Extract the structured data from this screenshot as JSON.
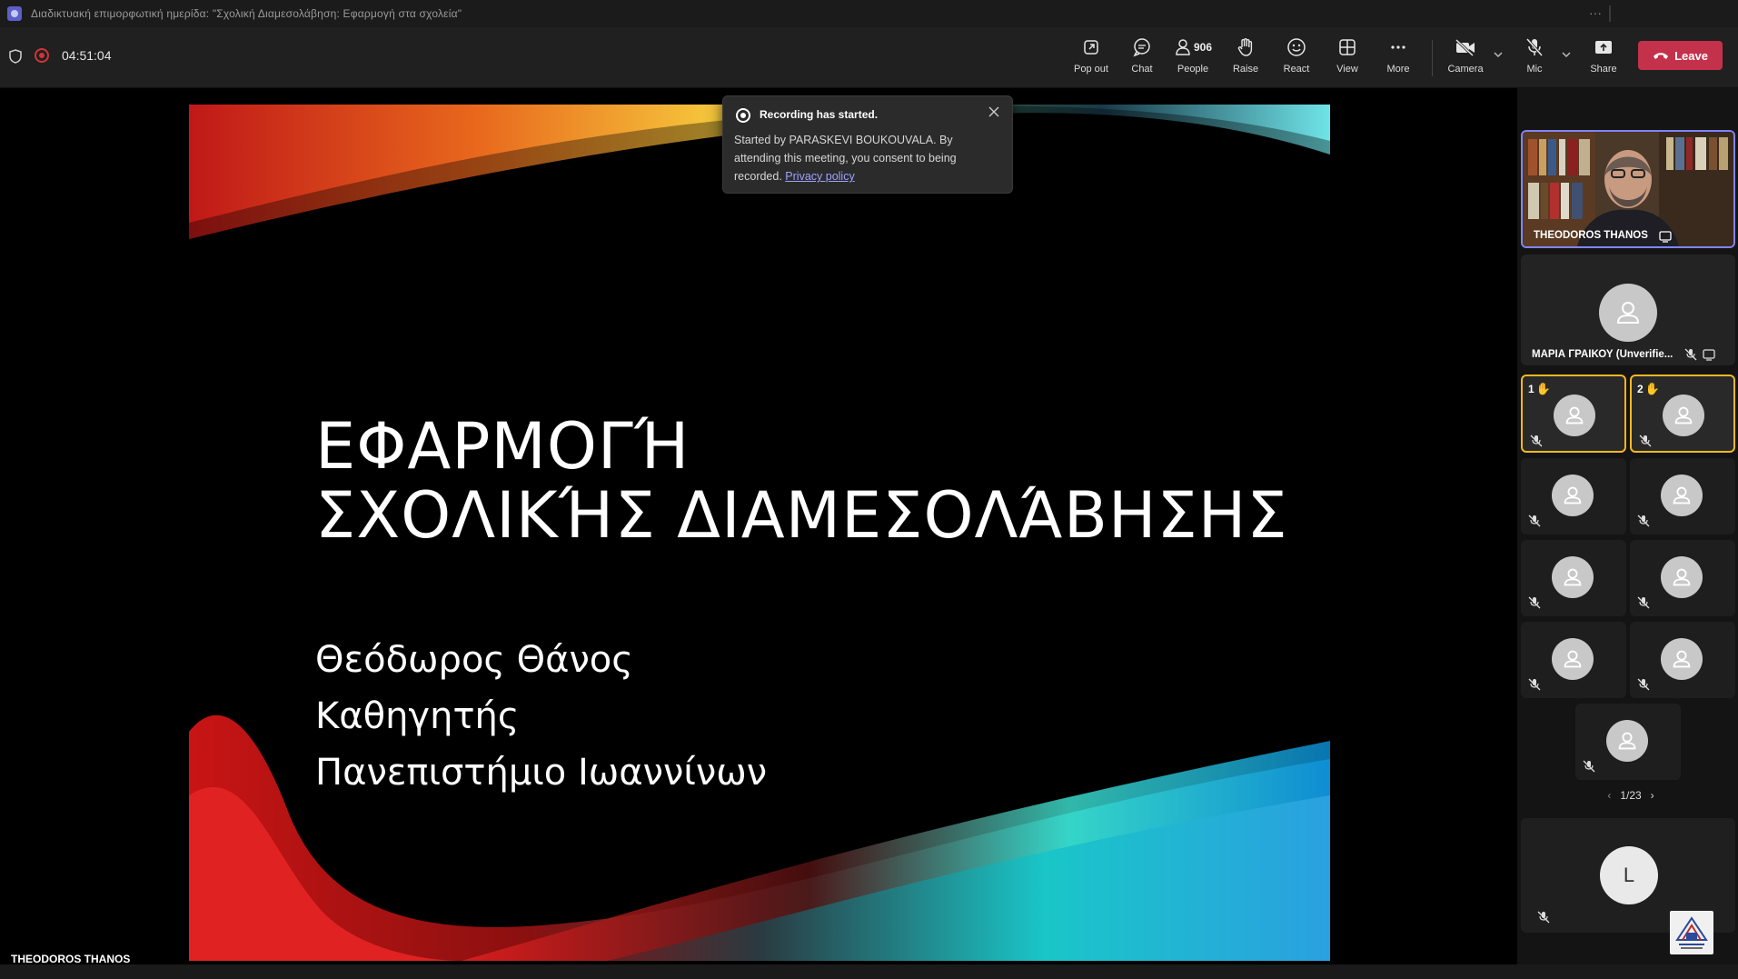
{
  "window": {
    "title": "Διαδικτυακή επιμορφωτική ημερίδα: \"Σχολική Διαμεσολάβηση: Εφαρμογή στα σχολεία\"",
    "more": "···"
  },
  "meeting": {
    "timer": "04:51:04",
    "recording_color": "#d13438"
  },
  "toolbar": {
    "popout": "Pop out",
    "chat": "Chat",
    "people": "People",
    "people_count": "906",
    "raise": "Raise",
    "react": "React",
    "view": "View",
    "more": "More",
    "camera": "Camera",
    "mic": "Mic",
    "share": "Share",
    "leave": "Leave",
    "leave_color": "#c4314b"
  },
  "toast": {
    "title": "Recording has started.",
    "body": "Started by PARASKEVI BOUKOUVALA. By attending this meeting, you consent to being recorded.",
    "link": "Privacy policy"
  },
  "slide": {
    "title_line1": "ΕΦΑΡΜΟΓΉ",
    "title_line2": "ΣΧΟΛΙΚΉΣ ΔΙΑΜΕΣΟΛΆΒΗΣΗΣ",
    "author": "Θεόδωρος Θάνος",
    "role": "Καθηγητής",
    "institution": "Πανεπιστήμιο Ιωαννίνων"
  },
  "presenter": {
    "name": "THEODOROS THANOS"
  },
  "participants": {
    "video_name": "THEODOROS THANOS",
    "second_name": "ΜΑΡΙΑ ΓΡΑΙΚΟΥ (Unverifie...",
    "hand1": "1",
    "hand2": "2",
    "pager": "1/23",
    "last_initial": "L"
  }
}
